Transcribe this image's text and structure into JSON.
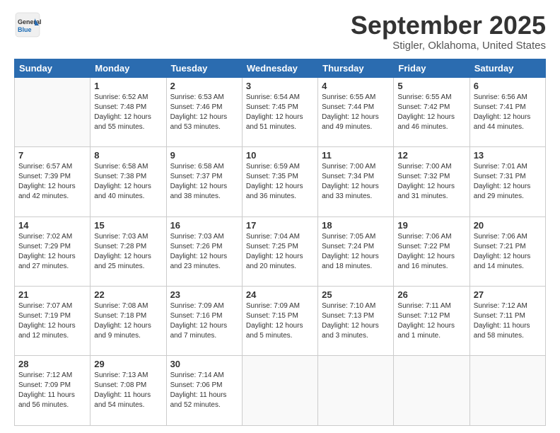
{
  "header": {
    "logo_general": "General",
    "logo_blue": "Blue",
    "title": "September 2025",
    "location": "Stigler, Oklahoma, United States"
  },
  "days_of_week": [
    "Sunday",
    "Monday",
    "Tuesday",
    "Wednesday",
    "Thursday",
    "Friday",
    "Saturday"
  ],
  "weeks": [
    [
      {
        "day": "",
        "info": ""
      },
      {
        "day": "1",
        "info": "Sunrise: 6:52 AM\nSunset: 7:48 PM\nDaylight: 12 hours\nand 55 minutes."
      },
      {
        "day": "2",
        "info": "Sunrise: 6:53 AM\nSunset: 7:46 PM\nDaylight: 12 hours\nand 53 minutes."
      },
      {
        "day": "3",
        "info": "Sunrise: 6:54 AM\nSunset: 7:45 PM\nDaylight: 12 hours\nand 51 minutes."
      },
      {
        "day": "4",
        "info": "Sunrise: 6:55 AM\nSunset: 7:44 PM\nDaylight: 12 hours\nand 49 minutes."
      },
      {
        "day": "5",
        "info": "Sunrise: 6:55 AM\nSunset: 7:42 PM\nDaylight: 12 hours\nand 46 minutes."
      },
      {
        "day": "6",
        "info": "Sunrise: 6:56 AM\nSunset: 7:41 PM\nDaylight: 12 hours\nand 44 minutes."
      }
    ],
    [
      {
        "day": "7",
        "info": "Sunrise: 6:57 AM\nSunset: 7:39 PM\nDaylight: 12 hours\nand 42 minutes."
      },
      {
        "day": "8",
        "info": "Sunrise: 6:58 AM\nSunset: 7:38 PM\nDaylight: 12 hours\nand 40 minutes."
      },
      {
        "day": "9",
        "info": "Sunrise: 6:58 AM\nSunset: 7:37 PM\nDaylight: 12 hours\nand 38 minutes."
      },
      {
        "day": "10",
        "info": "Sunrise: 6:59 AM\nSunset: 7:35 PM\nDaylight: 12 hours\nand 36 minutes."
      },
      {
        "day": "11",
        "info": "Sunrise: 7:00 AM\nSunset: 7:34 PM\nDaylight: 12 hours\nand 33 minutes."
      },
      {
        "day": "12",
        "info": "Sunrise: 7:00 AM\nSunset: 7:32 PM\nDaylight: 12 hours\nand 31 minutes."
      },
      {
        "day": "13",
        "info": "Sunrise: 7:01 AM\nSunset: 7:31 PM\nDaylight: 12 hours\nand 29 minutes."
      }
    ],
    [
      {
        "day": "14",
        "info": "Sunrise: 7:02 AM\nSunset: 7:29 PM\nDaylight: 12 hours\nand 27 minutes."
      },
      {
        "day": "15",
        "info": "Sunrise: 7:03 AM\nSunset: 7:28 PM\nDaylight: 12 hours\nand 25 minutes."
      },
      {
        "day": "16",
        "info": "Sunrise: 7:03 AM\nSunset: 7:26 PM\nDaylight: 12 hours\nand 23 minutes."
      },
      {
        "day": "17",
        "info": "Sunrise: 7:04 AM\nSunset: 7:25 PM\nDaylight: 12 hours\nand 20 minutes."
      },
      {
        "day": "18",
        "info": "Sunrise: 7:05 AM\nSunset: 7:24 PM\nDaylight: 12 hours\nand 18 minutes."
      },
      {
        "day": "19",
        "info": "Sunrise: 7:06 AM\nSunset: 7:22 PM\nDaylight: 12 hours\nand 16 minutes."
      },
      {
        "day": "20",
        "info": "Sunrise: 7:06 AM\nSunset: 7:21 PM\nDaylight: 12 hours\nand 14 minutes."
      }
    ],
    [
      {
        "day": "21",
        "info": "Sunrise: 7:07 AM\nSunset: 7:19 PM\nDaylight: 12 hours\nand 12 minutes."
      },
      {
        "day": "22",
        "info": "Sunrise: 7:08 AM\nSunset: 7:18 PM\nDaylight: 12 hours\nand 9 minutes."
      },
      {
        "day": "23",
        "info": "Sunrise: 7:09 AM\nSunset: 7:16 PM\nDaylight: 12 hours\nand 7 minutes."
      },
      {
        "day": "24",
        "info": "Sunrise: 7:09 AM\nSunset: 7:15 PM\nDaylight: 12 hours\nand 5 minutes."
      },
      {
        "day": "25",
        "info": "Sunrise: 7:10 AM\nSunset: 7:13 PM\nDaylight: 12 hours\nand 3 minutes."
      },
      {
        "day": "26",
        "info": "Sunrise: 7:11 AM\nSunset: 7:12 PM\nDaylight: 12 hours\nand 1 minute."
      },
      {
        "day": "27",
        "info": "Sunrise: 7:12 AM\nSunset: 7:11 PM\nDaylight: 11 hours\nand 58 minutes."
      }
    ],
    [
      {
        "day": "28",
        "info": "Sunrise: 7:12 AM\nSunset: 7:09 PM\nDaylight: 11 hours\nand 56 minutes."
      },
      {
        "day": "29",
        "info": "Sunrise: 7:13 AM\nSunset: 7:08 PM\nDaylight: 11 hours\nand 54 minutes."
      },
      {
        "day": "30",
        "info": "Sunrise: 7:14 AM\nSunset: 7:06 PM\nDaylight: 11 hours\nand 52 minutes."
      },
      {
        "day": "",
        "info": ""
      },
      {
        "day": "",
        "info": ""
      },
      {
        "day": "",
        "info": ""
      },
      {
        "day": "",
        "info": ""
      }
    ]
  ]
}
